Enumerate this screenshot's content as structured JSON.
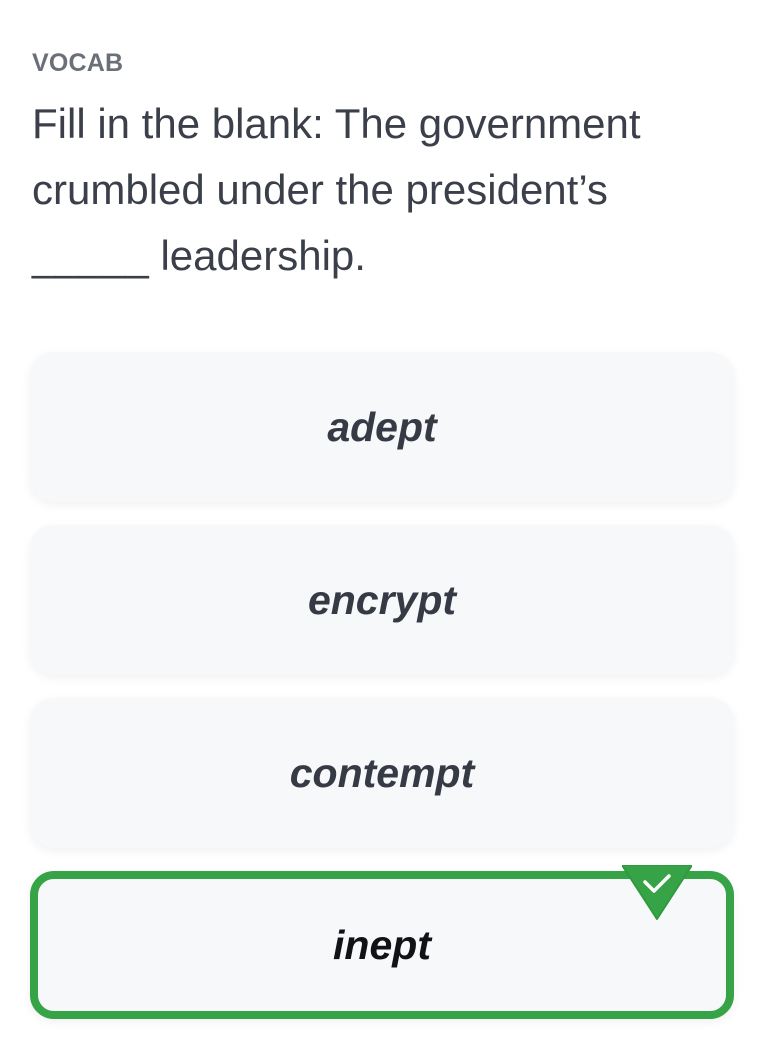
{
  "quiz": {
    "category": "VOCAB",
    "question": "Fill in the blank: The government crumbled under the president’s _____ leadership."
  },
  "options": [
    {
      "label": "adept",
      "state": "default"
    },
    {
      "label": "encrypt",
      "state": "default"
    },
    {
      "label": "contempt",
      "state": "default"
    },
    {
      "label": "inept",
      "state": "correct"
    }
  ],
  "colors": {
    "correct_accent": "#36a446",
    "option_background": "#f7f8fa",
    "text_primary": "#353a45",
    "category_text": "#6b7078"
  },
  "icons": {
    "correct_badge": "check-icon"
  }
}
